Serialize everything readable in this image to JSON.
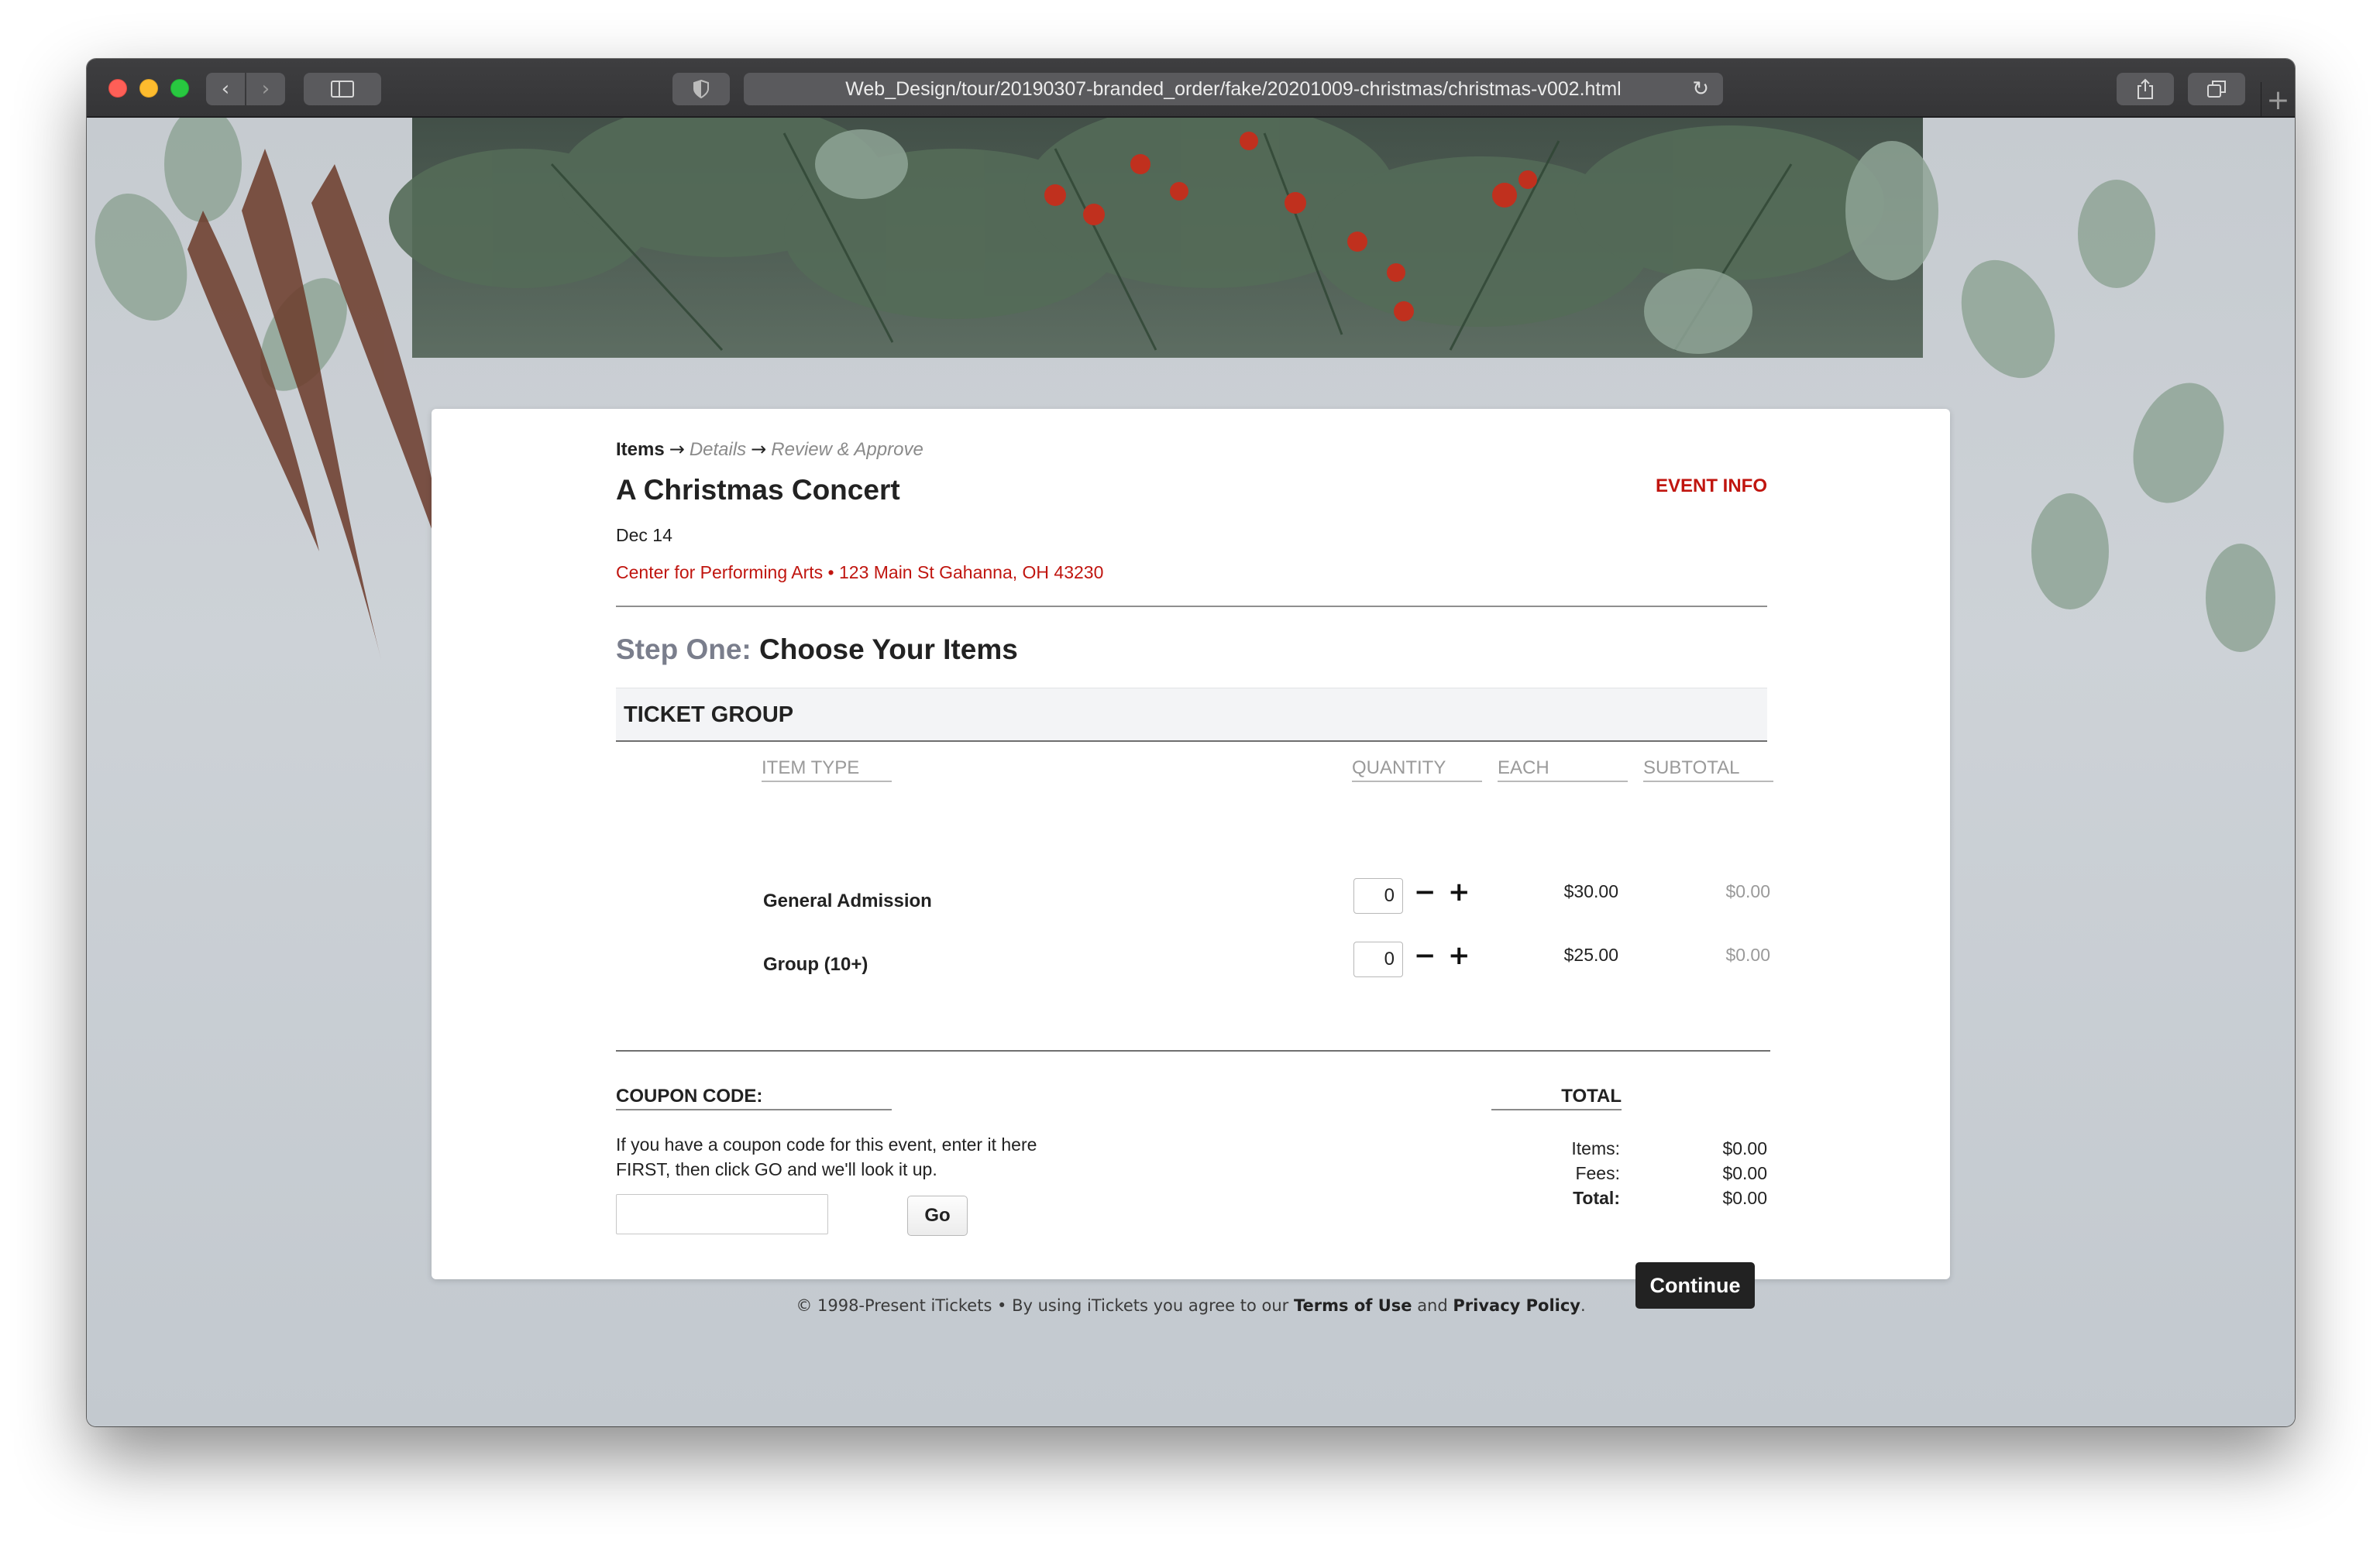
{
  "browser": {
    "url": "Web_Design/tour/20190307-branded_order/fake/20201009-christmas/christmas-v002.html",
    "icons": [
      "back-arrow-icon",
      "forward-arrow-icon",
      "sidebar-icon",
      "shield-icon",
      "reload-icon",
      "share-icon",
      "tabs-icon",
      "new-tab-icon"
    ]
  },
  "breadcrumb": {
    "current": "Items",
    "step2": "Details",
    "step3": "Review & Approve",
    "arrow": "→"
  },
  "event": {
    "title": "A Christmas Concert",
    "date": "Dec 14",
    "venue": "Center for Performing Arts • 123 Main St Gahanna, OH 43230",
    "info_link": "EVENT INFO"
  },
  "step": {
    "label": "Step One:",
    "title": "Choose Your Items"
  },
  "ticket_group": {
    "heading": "TICKET GROUP",
    "columns": {
      "item_type": "ITEM TYPE",
      "quantity": "QUANTITY",
      "each": "EACH",
      "subtotal": "SUBTOTAL"
    },
    "rows": [
      {
        "name": "General Admission",
        "qty": "0",
        "each": "$30.00",
        "subtotal": "$0.00"
      },
      {
        "name": "Group (10+)",
        "qty": "0",
        "each": "$25.00",
        "subtotal": "$0.00"
      }
    ]
  },
  "coupon": {
    "heading": "COUPON CODE:",
    "text": "If you have a coupon code for this event, enter it here FIRST, then click GO and we'll look it up.",
    "input_value": "",
    "go_label": "Go"
  },
  "totals": {
    "heading": "TOTAL",
    "items_label": "Items:",
    "items_value": "$0.00",
    "fees_label": "Fees:",
    "fees_value": "$0.00",
    "total_label": "Total:",
    "total_value": "$0.00"
  },
  "continue_label": "Continue",
  "footer": {
    "prefix": "© 1998-Present iTickets • By using iTickets you agree to our",
    "terms": "Terms of Use",
    "and": "and",
    "privacy": "Privacy Policy",
    "suffix": "."
  },
  "colors": {
    "accent_red": "#c0150f",
    "dark_button": "#222222"
  }
}
